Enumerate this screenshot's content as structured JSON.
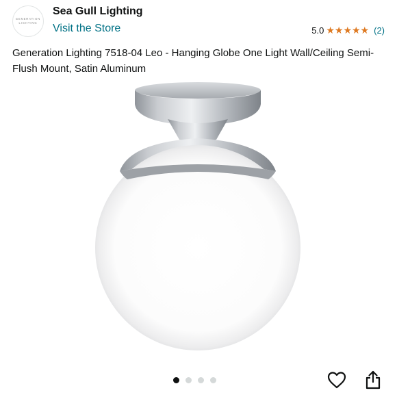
{
  "header": {
    "logo_lines": [
      "GENERATION",
      "LIGHTING"
    ],
    "brand_name": "Sea Gull Lighting",
    "store_link": "Visit the Store",
    "rating_score": "5.0",
    "stars": "★★★★★",
    "star_count": 5,
    "review_count": "(2)"
  },
  "product": {
    "title": "Generation Lighting 7518-04 Leo - Hanging Globe One Light Wall/Ceiling Semi-Flush Mount, Satin Aluminum"
  },
  "carousel": {
    "total_images": 4,
    "active_index": 0
  },
  "actions": {
    "favorite_icon": "heart-icon",
    "share_icon": "share-icon"
  },
  "colors": {
    "link": "#007185",
    "star": "#de7921",
    "text": "#0f1111"
  }
}
